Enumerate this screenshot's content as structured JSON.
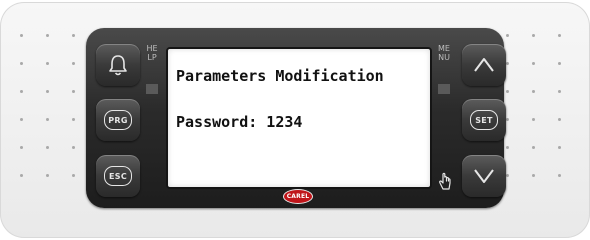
{
  "screen": {
    "line1": "Parameters Modification",
    "line2": "Password: 1234"
  },
  "left_labels": {
    "help": "HELP"
  },
  "right_labels": {
    "menu": "MENU"
  },
  "keys": {
    "alarm": {
      "icon": "bell-icon"
    },
    "prg": {
      "label": "PRG"
    },
    "esc": {
      "label": "ESC"
    },
    "up": {
      "icon": "chevron-up-icon"
    },
    "set": {
      "label": "SET"
    },
    "down": {
      "icon": "chevron-down-icon"
    }
  },
  "brand": {
    "logo": "CAREL",
    "color": "#c0151a"
  },
  "colors": {
    "bezel": "#2b2b2b",
    "screen_bg": "#ffffff",
    "screen_text": "#111111",
    "shell": "#efefef"
  }
}
